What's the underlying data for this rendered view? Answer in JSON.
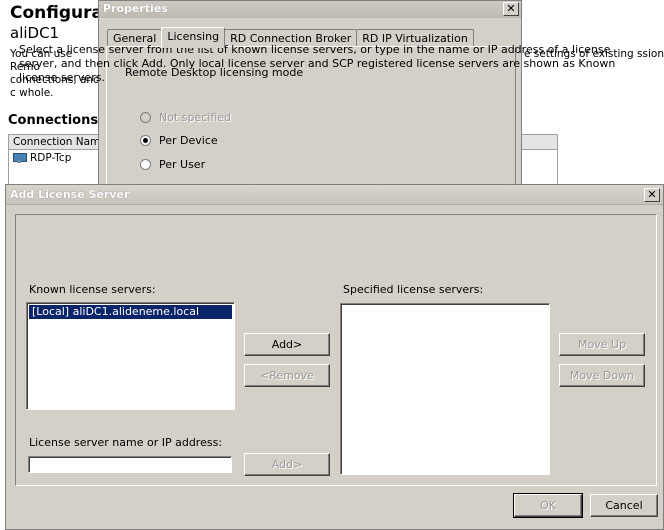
{
  "background": {
    "title": "Configurat",
    "server": "aliDC1",
    "desc_left": "You can use Remo connections, and c whole.",
    "desc_right": "e settings of existing ssion Host server as a",
    "connections_heading": "Connections",
    "table_header": "Connection Name",
    "table_row": "RDP-Tcp"
  },
  "properties_dialog": {
    "title": "Properties",
    "close": "✕",
    "tabs": [
      "General",
      "Licensing",
      "RD Connection Broker",
      "RD IP Virtualization"
    ],
    "active_tab": "Licensing",
    "licensing_mode_label": "Remote Desktop licensing mode",
    "options": [
      {
        "label": "Not specified",
        "checked": false,
        "disabled": true
      },
      {
        "label": "Per Device",
        "checked": true,
        "disabled": false
      },
      {
        "label": "Per User",
        "checked": false,
        "disabled": false
      }
    ]
  },
  "add_dialog": {
    "title": "Add License Server",
    "close": "✕",
    "instructions": "Select a license server from the list of known license servers, or type in the name or IP address of a license server, and then click Add. Only local license server and SCP registered license servers are shown as Known license servers.",
    "known_label": "Known license servers:",
    "known_servers": [
      "[Local] aliDC1.alideneme.local"
    ],
    "specified_label": "Specified license servers:",
    "specified_servers": [],
    "add_button": "Add>",
    "remove_button": "<Remove",
    "move_up_button": "Move Up",
    "move_down_button": "Move Down",
    "name_label": "License server name or IP address:",
    "name_value": "",
    "add_name_button": "Add>",
    "ok_button": "OK",
    "cancel_button": "Cancel"
  }
}
